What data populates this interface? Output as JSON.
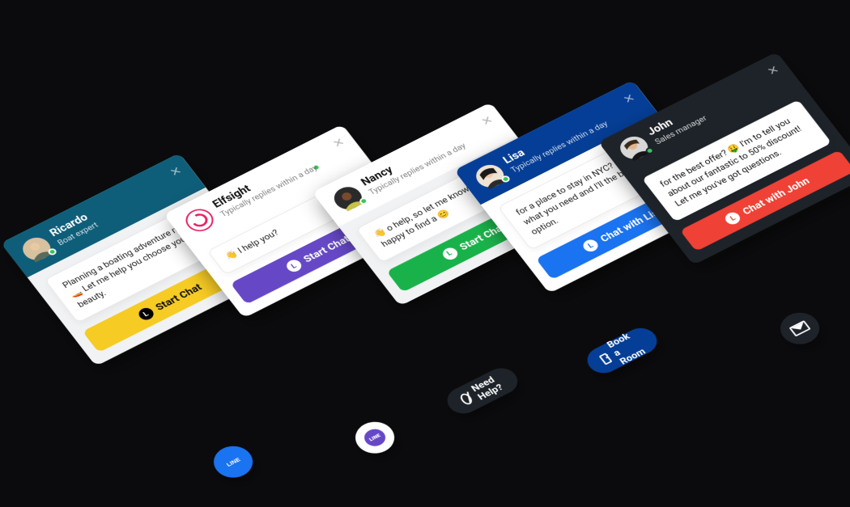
{
  "cards": [
    {
      "name": "Ricardo",
      "role": "Boat expert",
      "message": "Planning a boating adventure mate? 🚤 Let me help you choose your beauty.",
      "button": "Start Chat"
    },
    {
      "name": "Elfsight",
      "role": "Typically replies within a day",
      "message": "👋 I help you?",
      "button": "Start Chat"
    },
    {
      "name": "Nancy",
      "role": "Typically replies within a day",
      "message": "👋 o help, so let me know and I'll be happy to find a 😊",
      "button": "Start Chat"
    },
    {
      "name": "Lisa",
      "role": "Typically replies within a day",
      "message": "for a place to stay in NYC? know what you need and I'll the best option.",
      "button": "Chat with Lisa"
    },
    {
      "name": "John",
      "role": "Sales manager",
      "message": "for the best offer? 🤑 I'm to tell you about our fantastic to 50% discount! Let me you've got questions.",
      "button": "Chat with John"
    }
  ],
  "footer": {
    "need_help": "Need Help?",
    "book_room": "Book a Room"
  }
}
